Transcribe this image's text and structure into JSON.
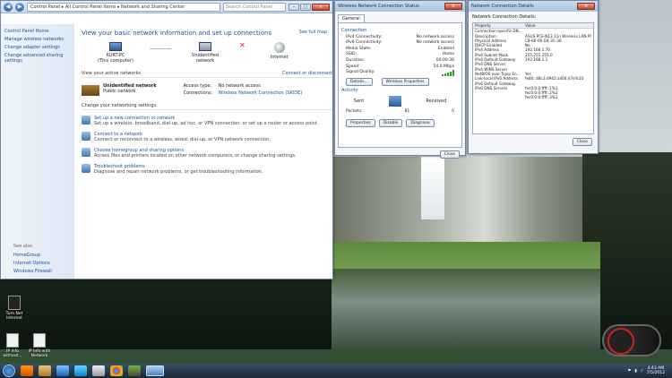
{
  "nsc": {
    "crumbs": "Control Panel ▸ All Control Panel Items ▸ Network and Sharing Center",
    "search": "Search Control Panel",
    "side": [
      "Control Panel Home",
      "Manage wireless networks",
      "Change adapter settings",
      "Change advanced sharing settings"
    ],
    "see_also": "See also",
    "see_items": [
      "HomeGroup",
      "Internet Options",
      "Windows Firewall"
    ],
    "title": "View your basic network information and set up connections",
    "full_map": "See full map",
    "nodes": [
      "KURT-PC\n(This computer)",
      "Unidentified network",
      "Internet"
    ],
    "active_label": "View your active networks",
    "connect": "Connect or disconnect",
    "net_name": "Unidentified network",
    "net_type": "Public network",
    "access_k": "Access type:",
    "access_v": "No network access",
    "conn_k": "Connections:",
    "conn_v": "Wireless Network Connection (SKIDE)",
    "change_label": "Change your networking settings",
    "tasks": [
      {
        "t": "Set up a new connection or network",
        "d": "Set up a wireless, broadband, dial-up, ad hoc, or VPN connection; or set up a router or access point."
      },
      {
        "t": "Connect to a network",
        "d": "Connect or reconnect to a wireless, wired, dial-up, or VPN network connection."
      },
      {
        "t": "Choose homegroup and sharing options",
        "d": "Access files and printers located on other network computers, or change sharing settings."
      },
      {
        "t": "Troubleshoot problems",
        "d": "Diagnose and repair network problems, or get troubleshooting information."
      }
    ]
  },
  "stat": {
    "title": "Wireless Network Connection Status",
    "tab": "General",
    "conn": "Connection",
    "rows": [
      [
        "IPv4 Connectivity:",
        "No network access"
      ],
      [
        "IPv6 Connectivity:",
        "No network access"
      ],
      [
        "Media State:",
        "Enabled"
      ],
      [
        "SSID:",
        "Home"
      ],
      [
        "Duration:",
        "00:00:36"
      ],
      [
        "Speed:",
        "54.0 Mbps"
      ]
    ],
    "signal": "Signal Quality:",
    "details": "Details...",
    "wprops": "Wireless Properties",
    "activity": "Activity",
    "sent": "Sent",
    "received": "Received",
    "packets": "Packets:",
    "sent_v": "81",
    "recv_v": "0",
    "props": "Properties",
    "disable": "Disable",
    "diagnose": "Diagnose",
    "close": "Close"
  },
  "det": {
    "title": "Network Connection Details",
    "head": "Network Connection Details:",
    "cols": [
      "Property",
      "Value"
    ],
    "rows": [
      [
        "Connection-specific DN...",
        ""
      ],
      [
        "Description",
        "ASUS PCE-N13 11n Wireless LAN PCI-E"
      ],
      [
        "Physical Address",
        "C8-60-00-D4-3C-36"
      ],
      [
        "DHCP Enabled",
        "No"
      ],
      [
        "IPv4 Address",
        "192.168.1.70"
      ],
      [
        "IPv4 Subnet Mask",
        "255.255.255.0"
      ],
      [
        "IPv4 Default Gateway",
        "192.168.1.1"
      ],
      [
        "IPv4 DNS Server",
        ""
      ],
      [
        "IPv4 WINS Server",
        ""
      ],
      [
        "NetBIOS over Tcpip En...",
        "Yes"
      ],
      [
        "Link-local IPv6 Address",
        "fe80::48c3:d942:a404:d7e%10"
      ],
      [
        "IPv6 Default Gateway",
        ""
      ],
      [
        "IPv6 DNS Servers",
        "fec0:0:0:ffff::1%1"
      ],
      [
        "",
        "fec0:0:0:ffff::2%1"
      ],
      [
        "",
        "fec0:0:0:ffff::3%1"
      ]
    ],
    "close": "Close"
  },
  "desktop": [
    {
      "label": "Turn Net Internet"
    },
    {
      "label": "IP Info without..."
    },
    {
      "label": "IP Info with Network"
    }
  ],
  "clock": {
    "time": "4:43 AM",
    "date": "7/5/2012"
  }
}
